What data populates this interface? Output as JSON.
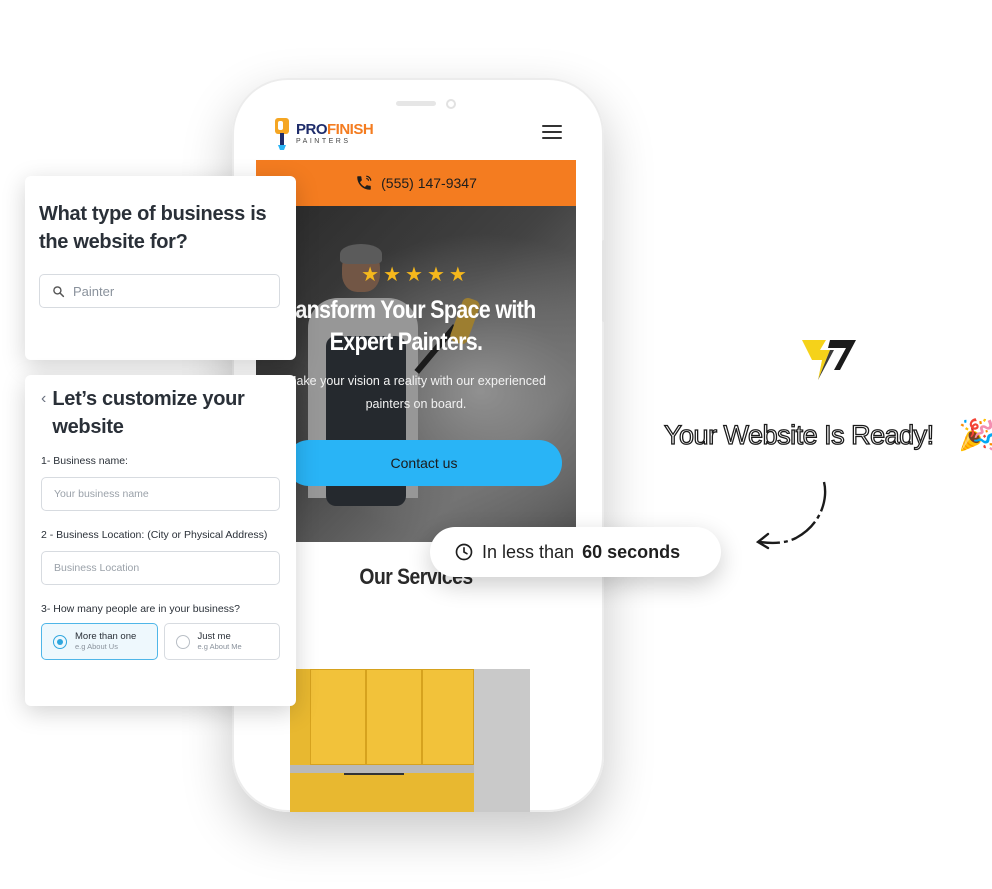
{
  "site": {
    "logo": {
      "pro": "PRO",
      "finish": "FINISH",
      "sub": "PAINTERS"
    },
    "phone_number": "(555) 147-9347",
    "hero": {
      "stars": "★★★★★",
      "title": "Transform Your Space with Expert Painters.",
      "subtitle": "Make your vision a reality with our experienced painters on board.",
      "cta": "Contact us"
    },
    "services_title": "Our Services"
  },
  "business_card": {
    "title": "What type of business is the website for?",
    "search_value": "Painter"
  },
  "customize_card": {
    "title": "Let’s customize your website",
    "q1_label": "1- Business name:",
    "q1_placeholder": "Your business name",
    "q2_label": "2 - Business Location: (City or Physical Address)",
    "q2_placeholder": "Business Location",
    "q3_label": "3- How many people are in your business?",
    "options": [
      {
        "label": "More than one",
        "sub": "e.g About Us",
        "selected": true
      },
      {
        "label": "Just me",
        "sub": "e.g About Me",
        "selected": false
      }
    ]
  },
  "timer_pill": {
    "prefix": "In less than",
    "highlight": "60 seconds"
  },
  "ready_text": "Your Website Is Ready!",
  "colors": {
    "accent_orange": "#f47c20",
    "cta_blue": "#29b4f6",
    "star_yellow": "#f6b81c",
    "brand_yellow": "#f5d21a"
  },
  "icons": [
    "phone-icon",
    "search-icon",
    "back-chevron-icon",
    "clock-icon",
    "menu-icon",
    "party-popper-icon",
    "brand-logo-icon",
    "curved-arrow-icon"
  ]
}
